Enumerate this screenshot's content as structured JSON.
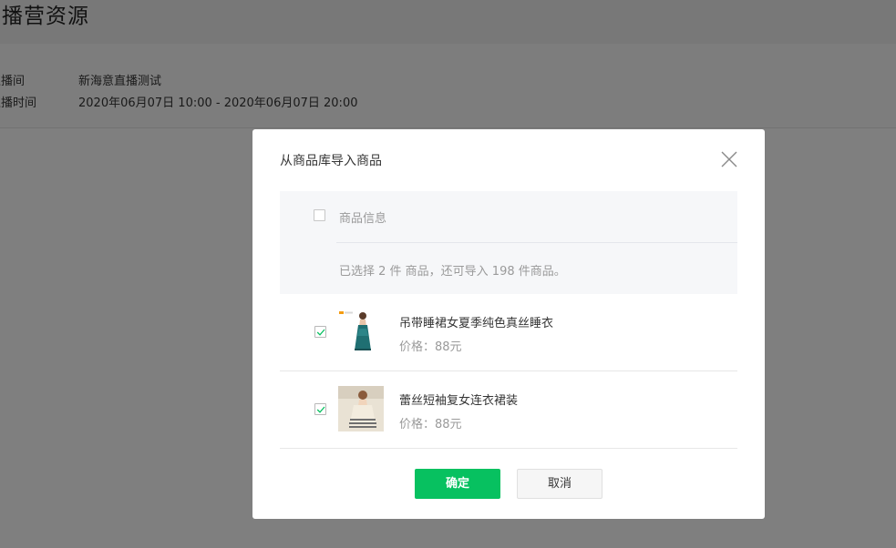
{
  "page": {
    "title": "直播营资源",
    "info": [
      {
        "label": "直播间",
        "value": "新海意直播测试"
      },
      {
        "label": "直播时间",
        "value": "2020年06月07日 10:00 - 2020年06月07日 20:00"
      }
    ]
  },
  "dialog": {
    "title": "从商品库导入商品",
    "close_icon": "close-icon",
    "table": {
      "header_label": "商品信息",
      "summary": "已选择 2 件 商品，还可导入 198 件商品。"
    },
    "items": [
      {
        "name": "吊带睡裙女夏季纯色真丝睡衣",
        "price": "价格：88元",
        "checked": true
      },
      {
        "name": "蕾丝短袖复女连衣裙装",
        "price": "价格：88元",
        "checked": true
      }
    ],
    "confirm_label": "确定",
    "cancel_label": "取消"
  },
  "colors": {
    "primary": "#07c160",
    "overlay": "rgba(0,0,0,0.5)",
    "check": "#07c160"
  }
}
